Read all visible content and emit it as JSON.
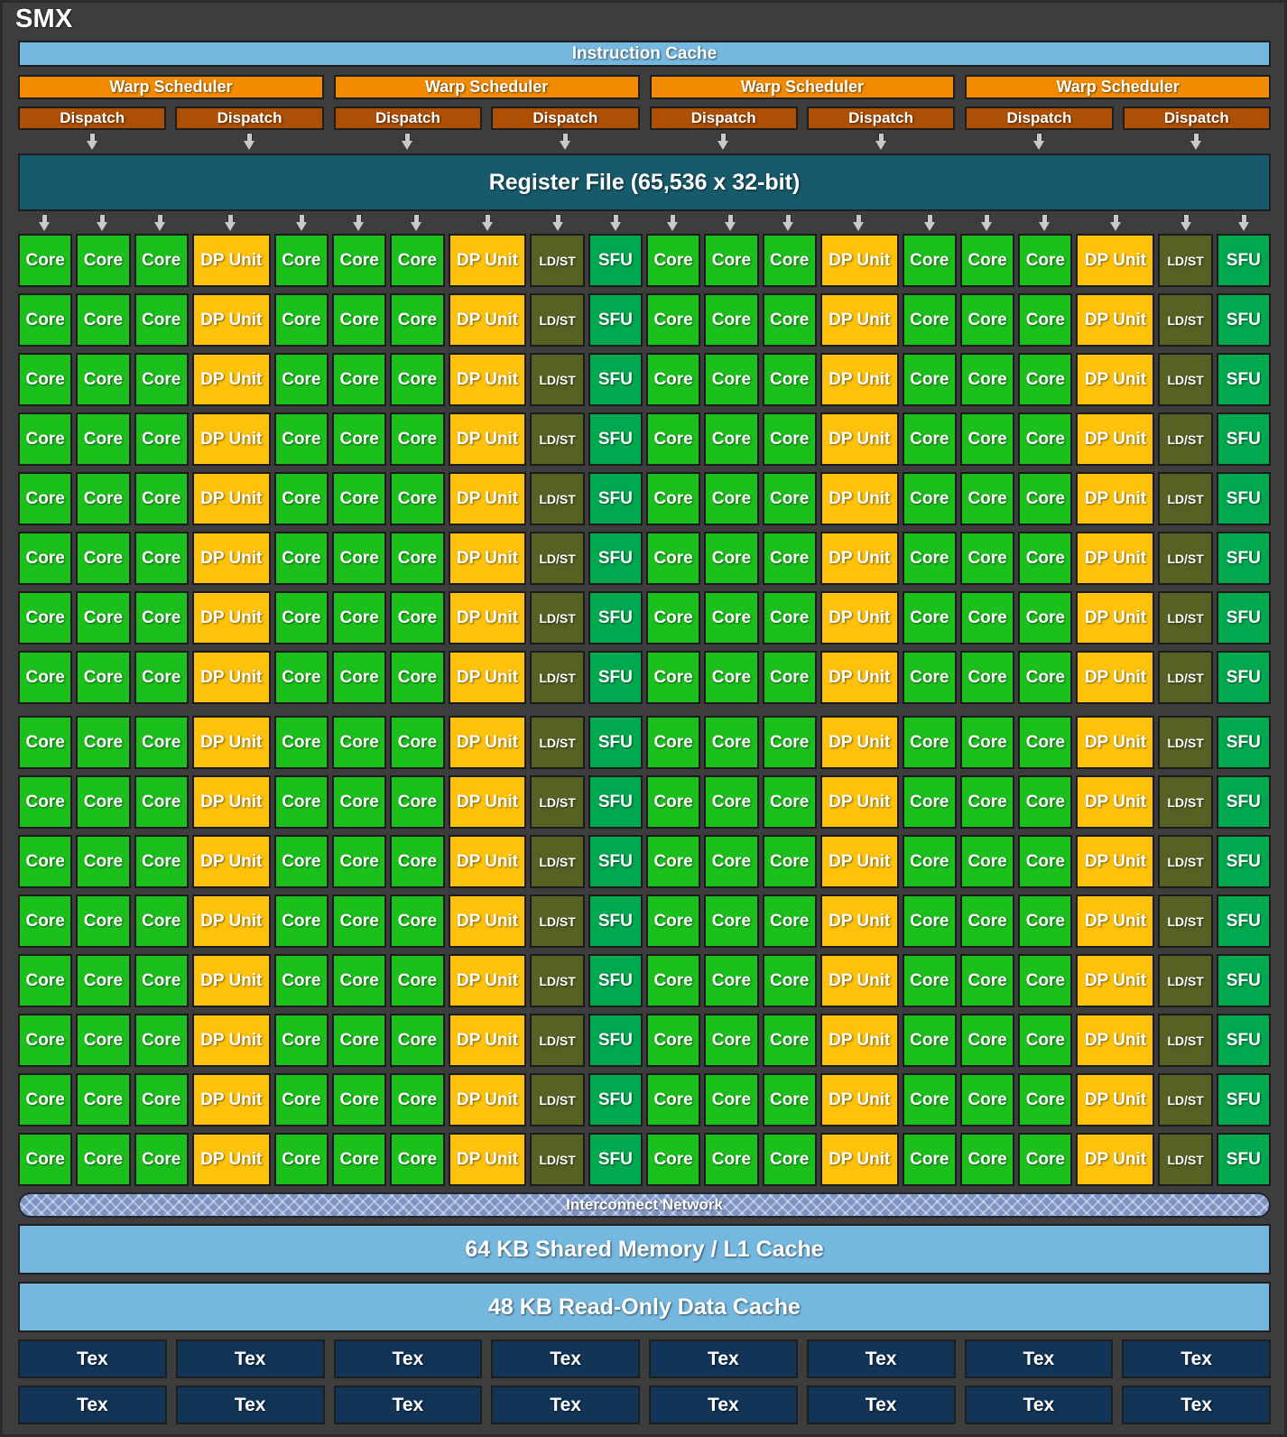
{
  "diagram": {
    "title": "SMX",
    "background": "#3d3d3d"
  },
  "instruction_cache": {
    "label": "Instruction Cache",
    "color": "#74b8e0"
  },
  "warp_schedulers": {
    "color": "#f28b00",
    "items": [
      {
        "label": "Warp Scheduler"
      },
      {
        "label": "Warp Scheduler"
      },
      {
        "label": "Warp Scheduler"
      },
      {
        "label": "Warp Scheduler"
      }
    ]
  },
  "dispatch": {
    "color": "#ad4f04",
    "items": [
      {
        "label": "Dispatch"
      },
      {
        "label": "Dispatch"
      },
      {
        "label": "Dispatch"
      },
      {
        "label": "Dispatch"
      },
      {
        "label": "Dispatch"
      },
      {
        "label": "Dispatch"
      },
      {
        "label": "Dispatch"
      },
      {
        "label": "Dispatch"
      }
    ]
  },
  "register_file": {
    "label": "Register File (65,536 x 32-bit)",
    "color": "#165a6b"
  },
  "execution_grid": {
    "rows": 16,
    "columns_per_half": 10,
    "halves": 2,
    "column_pattern": [
      "Core",
      "Core",
      "Core",
      "DP Unit",
      "Core",
      "Core",
      "Core",
      "DP Unit",
      "LD/ST",
      "SFU"
    ],
    "unit_colors": {
      "Core": "#1cc01c",
      "DP Unit": "#ffc20a",
      "LD/ST": "#566124",
      "SFU": "#00a84f"
    },
    "counts": {
      "Core": 192,
      "DP Unit": 64,
      "LD/ST": 32,
      "SFU": 32
    }
  },
  "interconnect": {
    "label": "Interconnect Network",
    "color": "#7e94c4"
  },
  "shared_memory": {
    "label": "64 KB Shared Memory / L1 Cache",
    "color": "#74b8e0"
  },
  "read_only_cache": {
    "label": "48 KB Read-Only Data Cache",
    "color": "#74b8e0"
  },
  "texture_units": {
    "color": "#123457",
    "per_row": 8,
    "rows": [
      [
        {
          "label": "Tex"
        },
        {
          "label": "Tex"
        },
        {
          "label": "Tex"
        },
        {
          "label": "Tex"
        },
        {
          "label": "Tex"
        },
        {
          "label": "Tex"
        },
        {
          "label": "Tex"
        },
        {
          "label": "Tex"
        }
      ],
      [
        {
          "label": "Tex"
        },
        {
          "label": "Tex"
        },
        {
          "label": "Tex"
        },
        {
          "label": "Tex"
        },
        {
          "label": "Tex"
        },
        {
          "label": "Tex"
        },
        {
          "label": "Tex"
        },
        {
          "label": "Tex"
        }
      ]
    ]
  }
}
